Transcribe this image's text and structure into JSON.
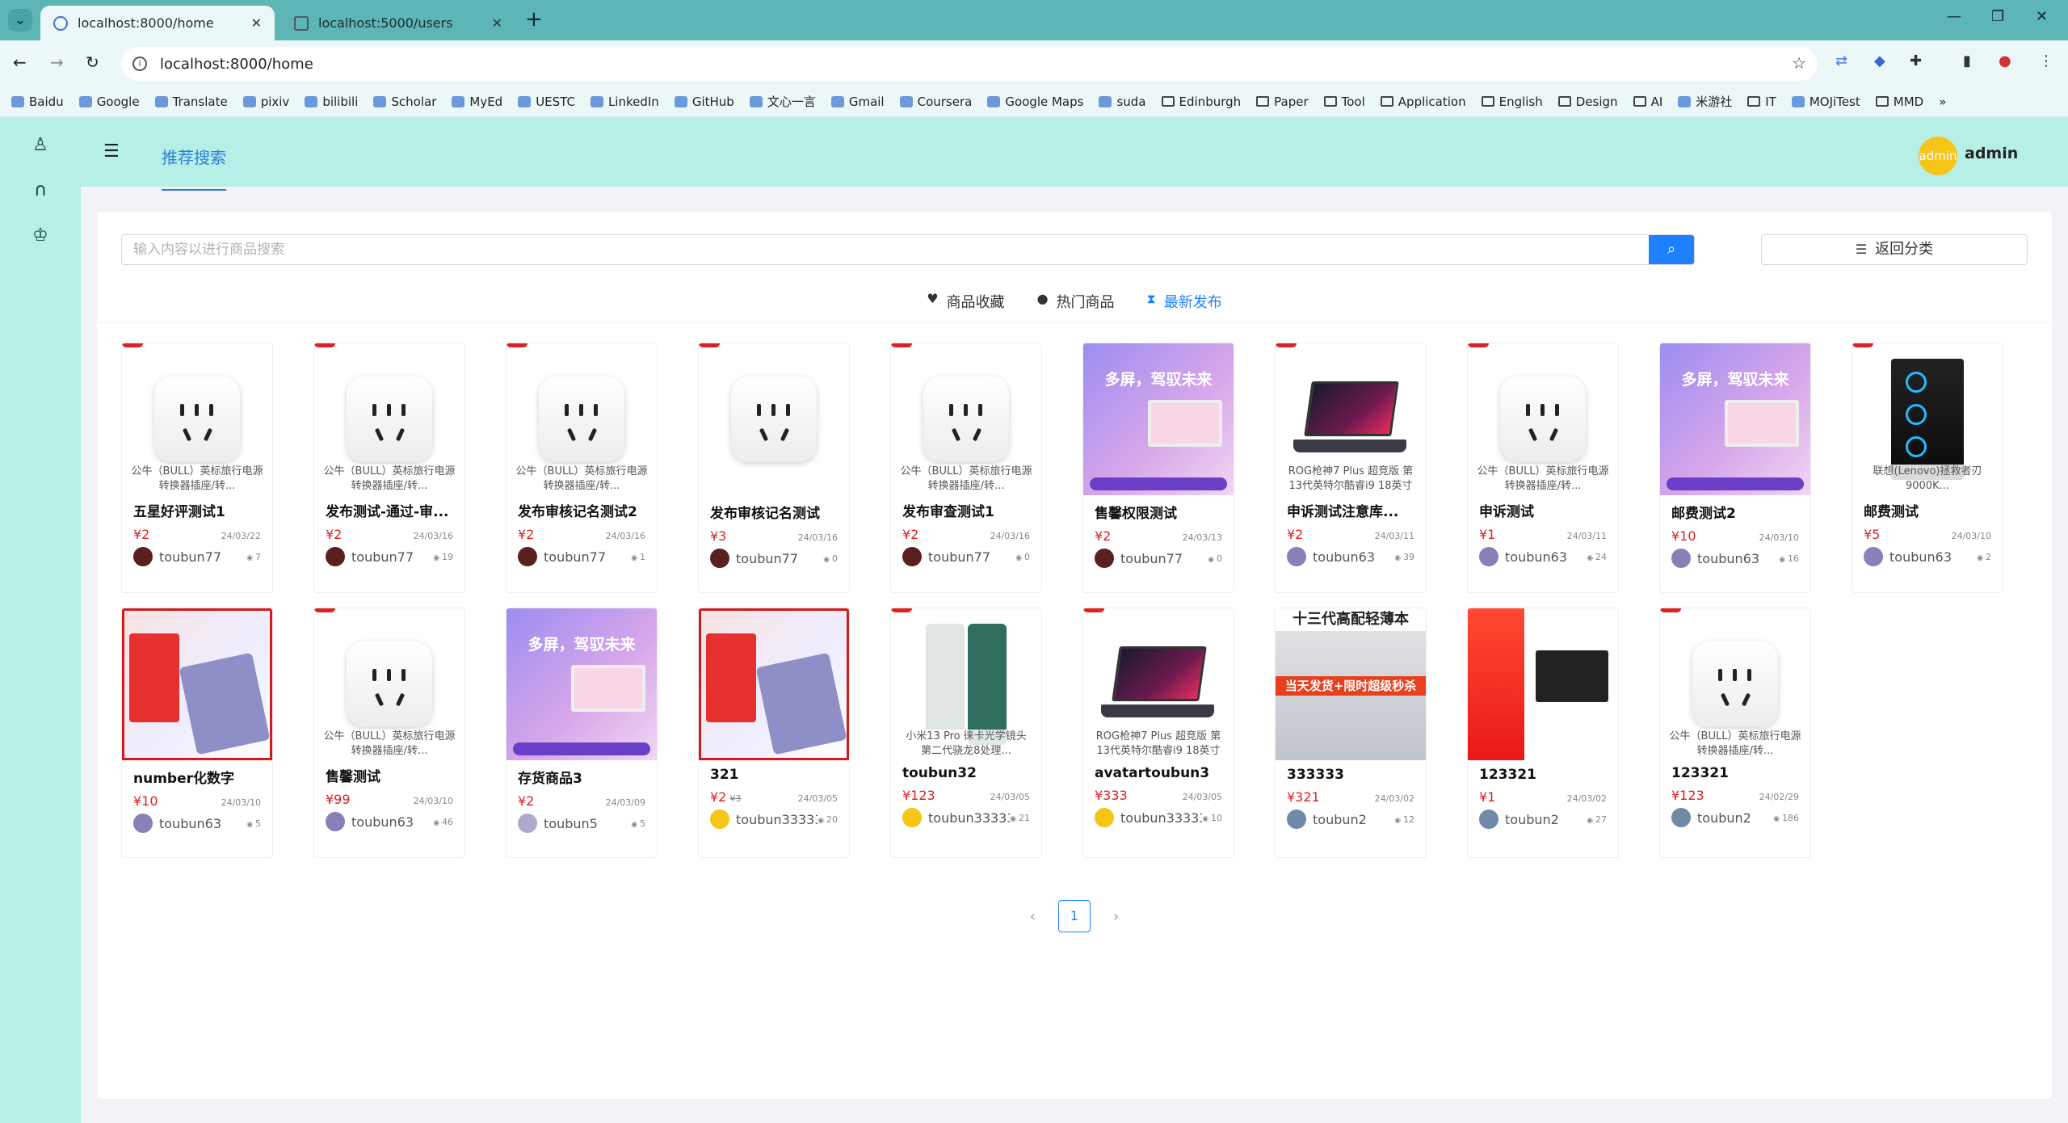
{
  "browser": {
    "tabs": [
      {
        "title": "localhost:8000/home",
        "close": "✕"
      },
      {
        "title": "localhost:5000/users",
        "close": "✕"
      }
    ],
    "url": "localhost:8000/home"
  },
  "bookmarks": [
    {
      "label": "Baidu",
      "folder": false
    },
    {
      "label": "Google",
      "folder": false
    },
    {
      "label": "Translate",
      "folder": false
    },
    {
      "label": "pixiv",
      "folder": false
    },
    {
      "label": "bilibili",
      "folder": false
    },
    {
      "label": "Scholar",
      "folder": false
    },
    {
      "label": "MyEd",
      "folder": false
    },
    {
      "label": "UESTC",
      "folder": false
    },
    {
      "label": "LinkedIn",
      "folder": false
    },
    {
      "label": "GitHub",
      "folder": false
    },
    {
      "label": "文心一言",
      "folder": false
    },
    {
      "label": "Gmail",
      "folder": false
    },
    {
      "label": "Coursera",
      "folder": false
    },
    {
      "label": "Google Maps",
      "folder": false
    },
    {
      "label": "suda",
      "folder": false
    },
    {
      "label": "Edinburgh",
      "folder": true
    },
    {
      "label": "Paper",
      "folder": true
    },
    {
      "label": "Tool",
      "folder": true
    },
    {
      "label": "Application",
      "folder": true
    },
    {
      "label": "English",
      "folder": true
    },
    {
      "label": "Design",
      "folder": true
    },
    {
      "label": "AI",
      "folder": true
    },
    {
      "label": "米游社",
      "folder": false
    },
    {
      "label": "IT",
      "folder": true
    },
    {
      "label": "MOJiTest",
      "folder": false
    },
    {
      "label": "MMD",
      "folder": true
    }
  ],
  "header": {
    "nav_tab": "推荐搜索",
    "avatar_text": "admin",
    "username": "admin"
  },
  "search": {
    "placeholder": "输入内容以进行商品搜索"
  },
  "back_button": "返回分类",
  "filters": [
    {
      "label": "商品收藏",
      "icon": "heart-icon",
      "active": false
    },
    {
      "label": "热门商品",
      "icon": "flame-icon",
      "active": false
    },
    {
      "label": "最新发布",
      "icon": "hourglass-icon",
      "active": true
    }
  ],
  "products": [
    {
      "img": "plug",
      "desc": "公牛（BULL）英标旅行电源转换器插座/转...",
      "title": "五星好评测试1",
      "price": "¥2",
      "date": "24/03/22",
      "user": "toubun77",
      "views": "7",
      "av": "#5a2020"
    },
    {
      "img": "plug",
      "desc": "公牛（BULL）英标旅行电源转换器插座/转...",
      "title": "发布测试-通过-审...",
      "price": "¥2",
      "date": "24/03/16",
      "user": "toubun77",
      "views": "19",
      "av": "#5a2020"
    },
    {
      "img": "plug",
      "desc": "公牛（BULL）英标旅行电源转换器插座/转...",
      "title": "发布审核记名测试2",
      "price": "¥2",
      "date": "24/03/16",
      "user": "toubun77",
      "views": "1",
      "av": "#5a2020"
    },
    {
      "img": "plug",
      "desc": "",
      "title": "发布审核记名测试",
      "price": "¥3",
      "date": "24/03/16",
      "user": "toubun77",
      "views": "0",
      "av": "#5a2020"
    },
    {
      "img": "plug",
      "desc": "公牛（BULL）英标旅行电源转换器插座/转...",
      "title": "发布审查测试1",
      "price": "¥2",
      "date": "24/03/16",
      "user": "toubun77",
      "views": "0",
      "av": "#5a2020"
    },
    {
      "img": "promo",
      "desc": "",
      "title": "售馨权限测试",
      "price": "¥2",
      "date": "24/03/13",
      "user": "toubun77",
      "views": "0",
      "av": "#5a2020"
    },
    {
      "img": "laptop",
      "desc": "ROG枪神7 Plus 超竞版 第13代英特尔酷睿i9 18英寸",
      "title": "申诉测试注意库...",
      "price": "¥2",
      "date": "24/03/11",
      "user": "toubun63",
      "views": "39",
      "av": "#8a80b8"
    },
    {
      "img": "plug",
      "desc": "公牛（BULL）英标旅行电源转换器插座/转...",
      "title": "申诉测试",
      "price": "¥1",
      "date": "24/03/11",
      "user": "toubun63",
      "views": "24",
      "av": "#8a80b8"
    },
    {
      "img": "promo",
      "desc": "",
      "title": "邮费测试2",
      "price": "¥10",
      "date": "24/03/10",
      "user": "toubun63",
      "views": "16",
      "av": "#8a80b8"
    },
    {
      "img": "tower",
      "desc": "联想(Lenovo)拯救者刃9000K...",
      "title": "邮费测试",
      "price": "¥5",
      "date": "24/03/10",
      "user": "toubun63",
      "views": "2",
      "av": "#8a80b8"
    },
    {
      "img": "tablet",
      "desc": "",
      "title": "number化数字",
      "price": "¥10",
      "date": "24/03/10",
      "user": "toubun63",
      "views": "5",
      "av": "#8a80b8"
    },
    {
      "img": "plug",
      "desc": "公牛（BULL）英标旅行电源转换器插座/转...",
      "title": "售馨测试",
      "price": "¥99",
      "date": "24/03/10",
      "user": "toubun63",
      "views": "46",
      "av": "#8a80b8"
    },
    {
      "img": "promo",
      "desc": "",
      "title": "存货商品3",
      "price": "¥2",
      "date": "24/03/09",
      "user": "toubun5",
      "views": "5",
      "av": "#b0a8d0"
    },
    {
      "img": "tablet",
      "desc": "",
      "title": "321",
      "price": "¥2",
      "date": "24/03/05",
      "user": "toubun333333",
      "views": "20",
      "av": "#f5c518",
      "old": "¥3"
    },
    {
      "img": "phone",
      "desc": "小米13 Pro 徕卡光学镜头 第二代骁龙8处理...",
      "title": "toubun32",
      "price": "¥123",
      "date": "24/03/05",
      "user": "toubun333333",
      "views": "21",
      "av": "#f5c518"
    },
    {
      "img": "laptop",
      "desc": "ROG枪神7 Plus 超竞版 第13代英特尔酷睿i9 18英寸",
      "title": "avatartoubun3",
      "price": "¥333",
      "date": "24/03/05",
      "user": "toubun333333",
      "views": "10",
      "av": "#f5c518"
    },
    {
      "img": "sale",
      "desc": "",
      "title": "333333",
      "price": "¥321",
      "date": "24/03/02",
      "user": "toubun2",
      "views": "12",
      "av": "#6f8aa8"
    },
    {
      "img": "lenovo",
      "desc": "",
      "title": "123321",
      "price": "¥1",
      "date": "24/03/02",
      "user": "toubun2",
      "views": "27",
      "av": "#6f8aa8"
    },
    {
      "img": "plug",
      "desc": "公牛（BULL）英标旅行电源转换器插座/转...",
      "title": "123321",
      "price": "¥123",
      "date": "24/02/29",
      "user": "toubun2",
      "views": "186",
      "av": "#6f8aa8"
    }
  ],
  "pagination": {
    "current": "1"
  },
  "promo_text": {
    "headline": "多屏，驾驭未来"
  },
  "sale_text": {
    "banner": "十三代高配轻薄本",
    "ribbon": "当天发货+限时超级秒杀"
  },
  "colors": {
    "accent": "#1e80ff",
    "header_bg": "#b6efe6",
    "price": "#e02020"
  }
}
